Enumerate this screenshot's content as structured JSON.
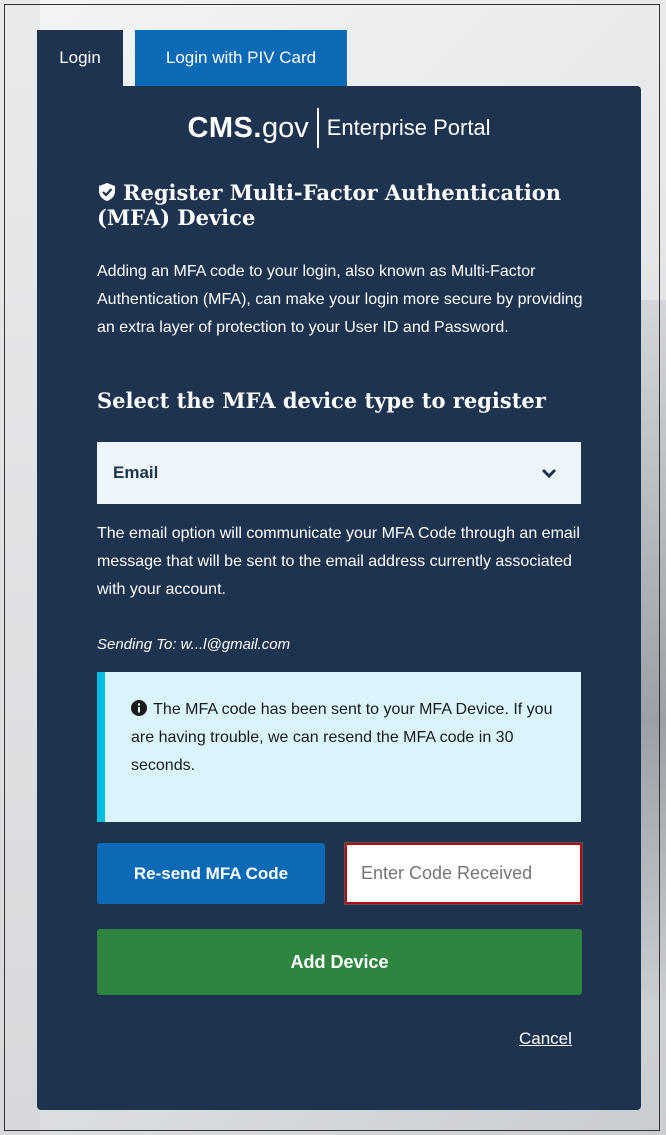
{
  "tabs": {
    "login": "Login",
    "piv": "Login with PIV Card"
  },
  "logo": {
    "cms": "CMS.",
    "gov": "gov",
    "portal": "Enterprise Portal"
  },
  "heading": "Register Multi-Factor Authentication (MFA) Device",
  "description": "Adding an MFA code to your login, also known as Multi-Factor Authentication (MFA), can make your login more secure by providing an extra layer of protection to your User ID and Password.",
  "select_heading": "Select the MFA device type to register",
  "device_select": {
    "value": "Email"
  },
  "email_description": "The email option will communicate your MFA Code through an email message that will be sent to the email address currently associated with your account.",
  "sending_to": "Sending To: w...l@gmail.com",
  "alert": {
    "text": "The MFA code has been sent to your MFA Device. If you are having trouble, we can resend the MFA code in 30 seconds."
  },
  "buttons": {
    "resend": "Re-send MFA Code",
    "add_device": "Add Device",
    "cancel": "Cancel"
  },
  "code_input": {
    "placeholder": "Enter Code Received",
    "value": ""
  },
  "colors": {
    "panel": "#1e3350",
    "primary": "#0a6ab5",
    "success": "#2e8540",
    "alert_bg": "#d9f4fb",
    "alert_border": "#00bde3"
  }
}
